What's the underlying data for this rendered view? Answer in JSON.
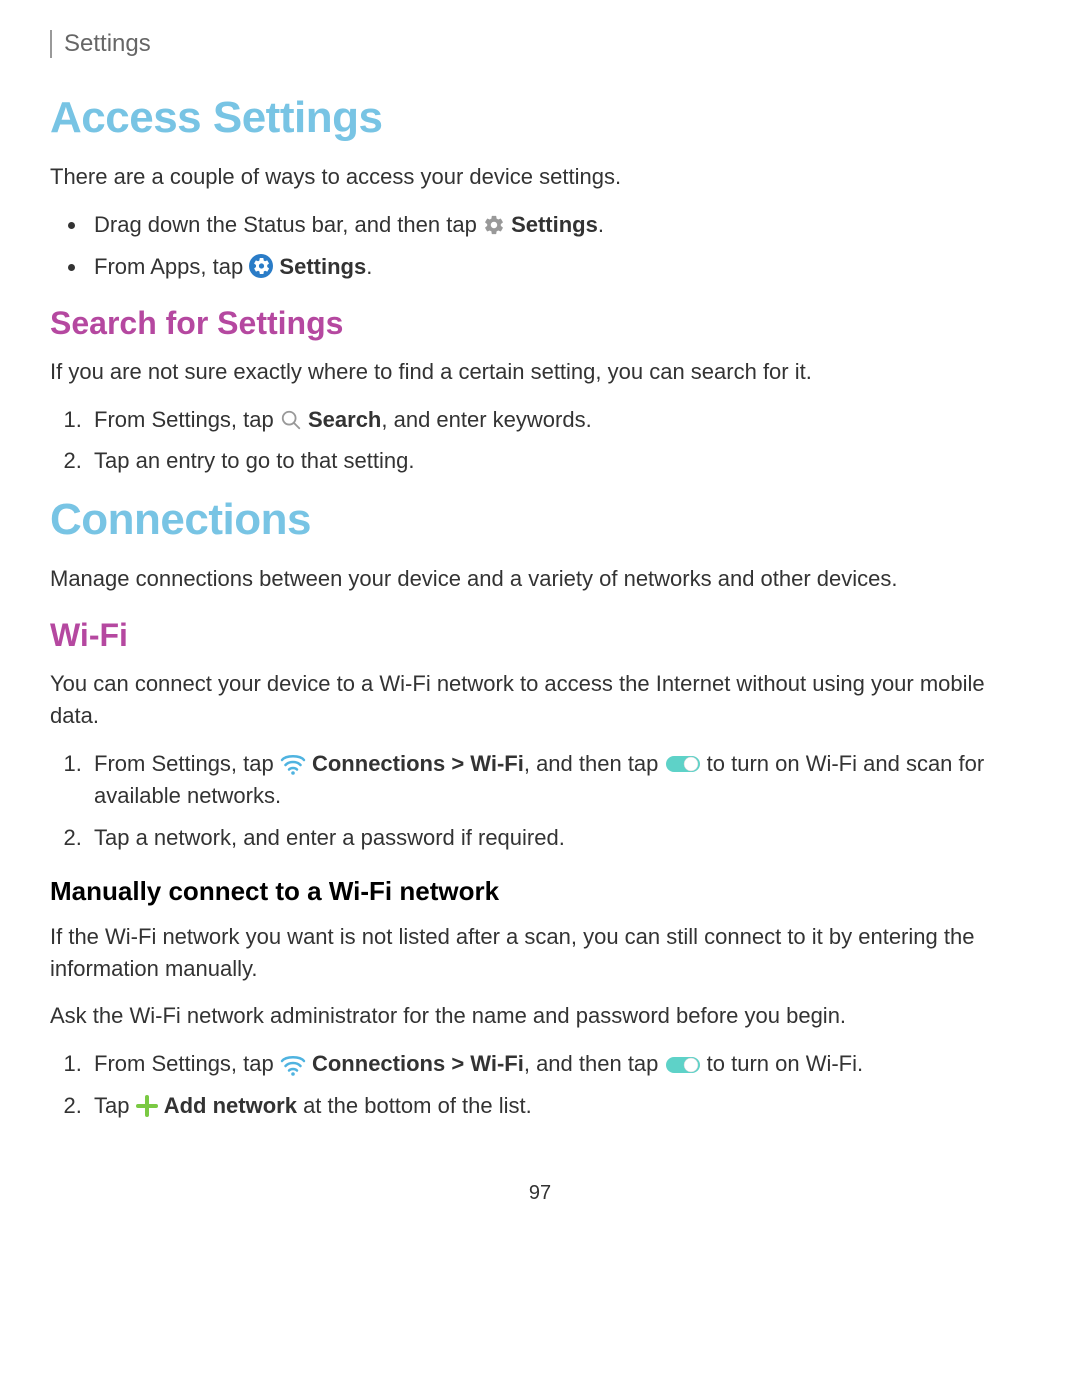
{
  "header": "Settings",
  "section1": {
    "title": "Access Settings",
    "intro": "There are a couple of ways to access your device settings.",
    "bullet1_a": "Drag down the Status bar, and then tap ",
    "bullet1_b": "Settings",
    "bullet1_c": ".",
    "bullet2_a": "From Apps, tap ",
    "bullet2_b": "Settings",
    "bullet2_c": "."
  },
  "section2": {
    "title": "Search for Settings",
    "intro": "If you are not sure exactly where to find a certain setting, you can search for it.",
    "step1_a": "From Settings, tap ",
    "step1_b": "Search",
    "step1_c": ", and enter keywords.",
    "step2": "Tap an entry to go to that setting."
  },
  "section3": {
    "title": "Connections",
    "intro": "Manage connections between your device and a variety of networks and other devices."
  },
  "section4": {
    "title": "Wi-Fi",
    "intro": "You can connect your device to a Wi-Fi network to access the Internet without using your mobile data.",
    "step1_a": "From Settings, tap ",
    "step1_b": "Connections > Wi-Fi",
    "step1_c": ", and then tap ",
    "step1_d": " to turn on Wi-Fi and scan for available networks.",
    "step2": "Tap a network, and enter a password if required."
  },
  "section5": {
    "title": "Manually connect to a Wi-Fi network",
    "intro1": "If the Wi-Fi network you want is not listed after a scan, you can still connect to it by entering the information manually.",
    "intro2": "Ask the Wi-Fi network administrator for the name and password before you begin.",
    "step1_a": "From Settings, tap ",
    "step1_b": "Connections > Wi-Fi",
    "step1_c": ", and then tap ",
    "step1_d": " to turn on Wi-Fi.",
    "step2_a": "Tap ",
    "step2_b": "Add network",
    "step2_c": " at the bottom of the list."
  },
  "pageNumber": "97"
}
